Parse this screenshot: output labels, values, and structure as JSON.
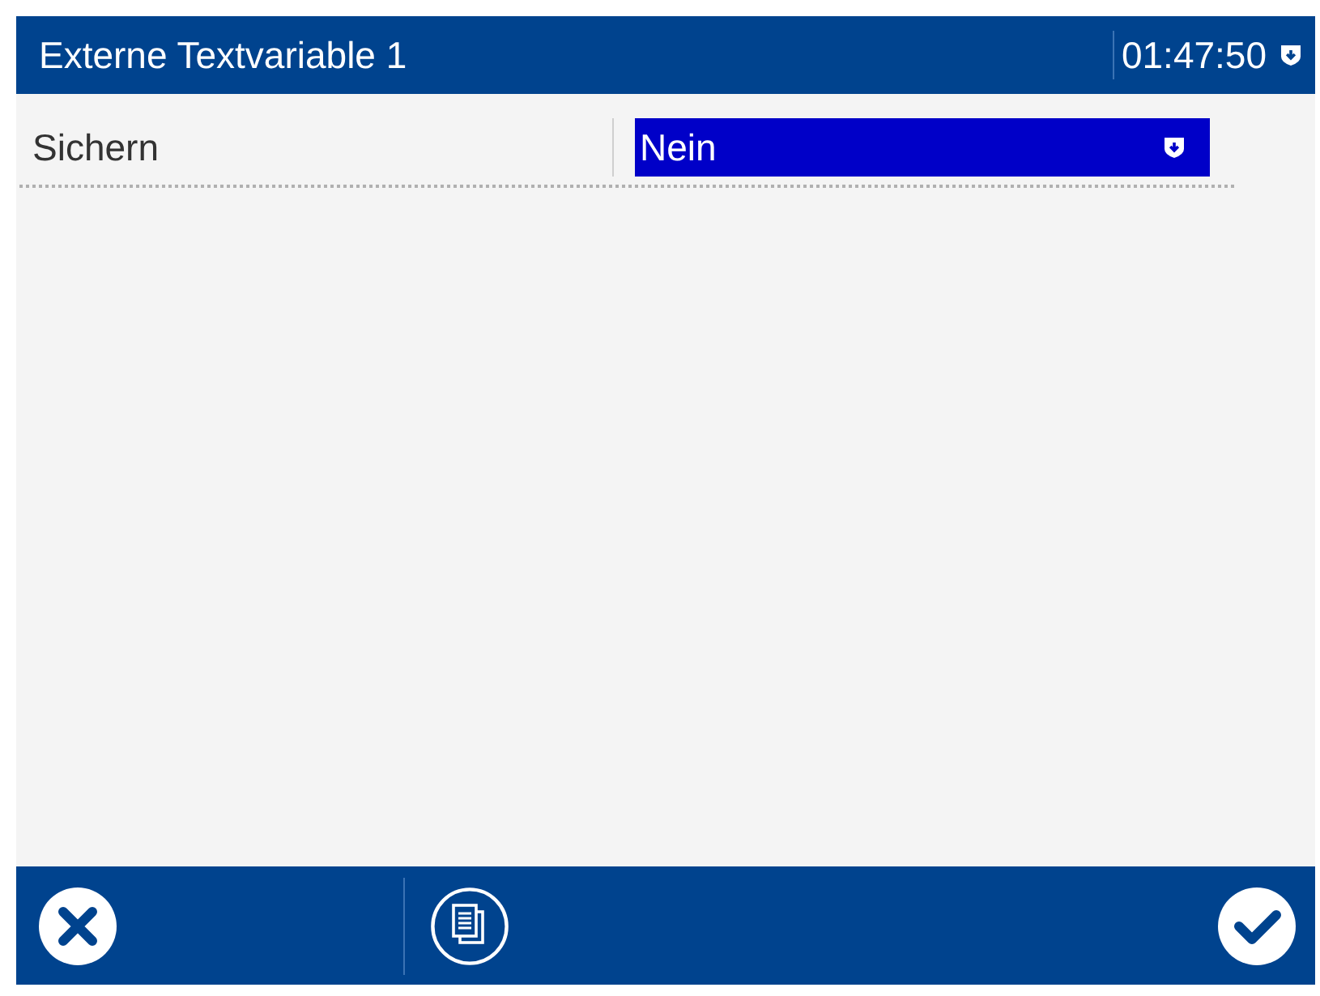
{
  "header": {
    "title": "Externe Textvariable 1",
    "time": "01:47:50"
  },
  "settings": [
    {
      "kind": "dropdown",
      "label": "Sichern",
      "value": "Nein",
      "selected": true
    }
  ]
}
